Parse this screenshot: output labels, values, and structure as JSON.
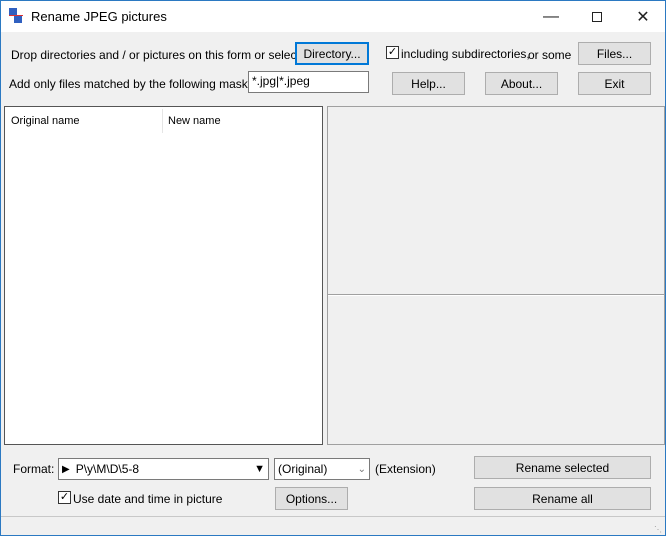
{
  "window": {
    "title": "Rename JPEG pictures",
    "icon": "app-picture-icon",
    "minimize": "minimize-icon",
    "maximize": "maximize-icon",
    "close": "close-icon"
  },
  "top": {
    "drop_label": "Drop directories and / or pictures on this form or select a",
    "directory_button": "Directory...",
    "include_subdirs_label": "including subdirectories,",
    "include_subdirs_checked": true,
    "or_some_label": "or some",
    "files_button": "Files...",
    "mask_label": "Add only files matched by the following mask(s) :",
    "mask_value": "*.jpg|*.jpeg",
    "help_button": "Help...",
    "about_button": "About...",
    "exit_button": "Exit"
  },
  "list": {
    "columns": [
      "Original name",
      "New name"
    ],
    "rows": []
  },
  "bottom": {
    "format_label": "Format:",
    "format_value": "P\\y\\M\\D\\5-8",
    "extension_value": "(Original)",
    "extension_label": "(Extension)",
    "use_date_label": "Use date and time in picture",
    "use_date_checked": true,
    "options_button": "Options...",
    "rename_selected_button": "Rename selected",
    "rename_all_button": "Rename all"
  }
}
